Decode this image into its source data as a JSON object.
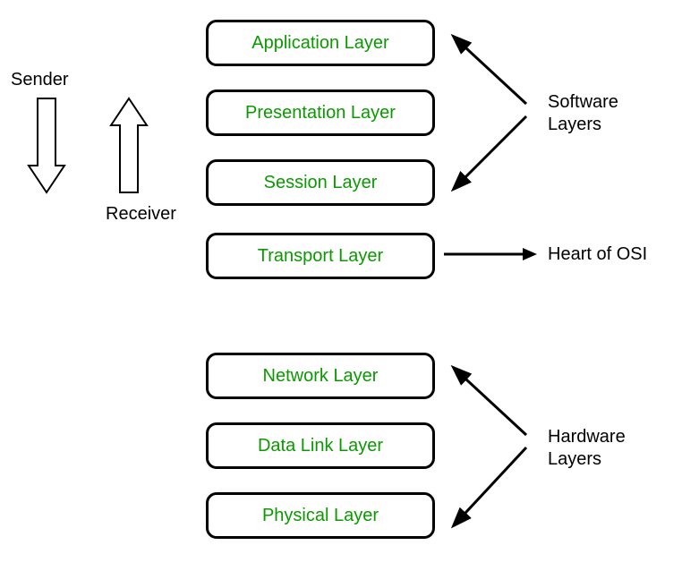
{
  "diagram": {
    "layers": [
      "Application Layer",
      "Presentation Layer",
      "Session Layer",
      "Transport Layer",
      "Network Layer",
      "Data Link Layer",
      "Physical Layer"
    ],
    "arrows": {
      "sender_label": "Sender",
      "receiver_label": "Receiver"
    },
    "groups": {
      "software_label_line1": "Software",
      "software_label_line2": "Layers",
      "heart_label": "Heart of OSI",
      "hardware_label_line1": "Hardware",
      "hardware_label_line2": "Layers"
    }
  }
}
